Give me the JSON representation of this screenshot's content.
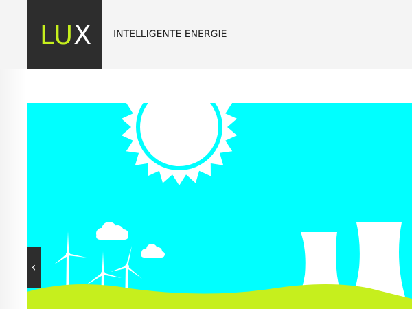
{
  "header": {
    "logo": {
      "accent_part": "LU",
      "rest_part": "X"
    },
    "tagline": "INTELLIGENTE ENERGIE"
  },
  "slider": {
    "prev_arrow": "‹",
    "prev_icon": "chevron-left-icon"
  },
  "colors": {
    "sky": "#00ffff",
    "hill": "#c6ef1d",
    "logo_bg": "#2d2d2d",
    "logo_accent": "#c6ef1d",
    "illustration": "#ffffff"
  }
}
